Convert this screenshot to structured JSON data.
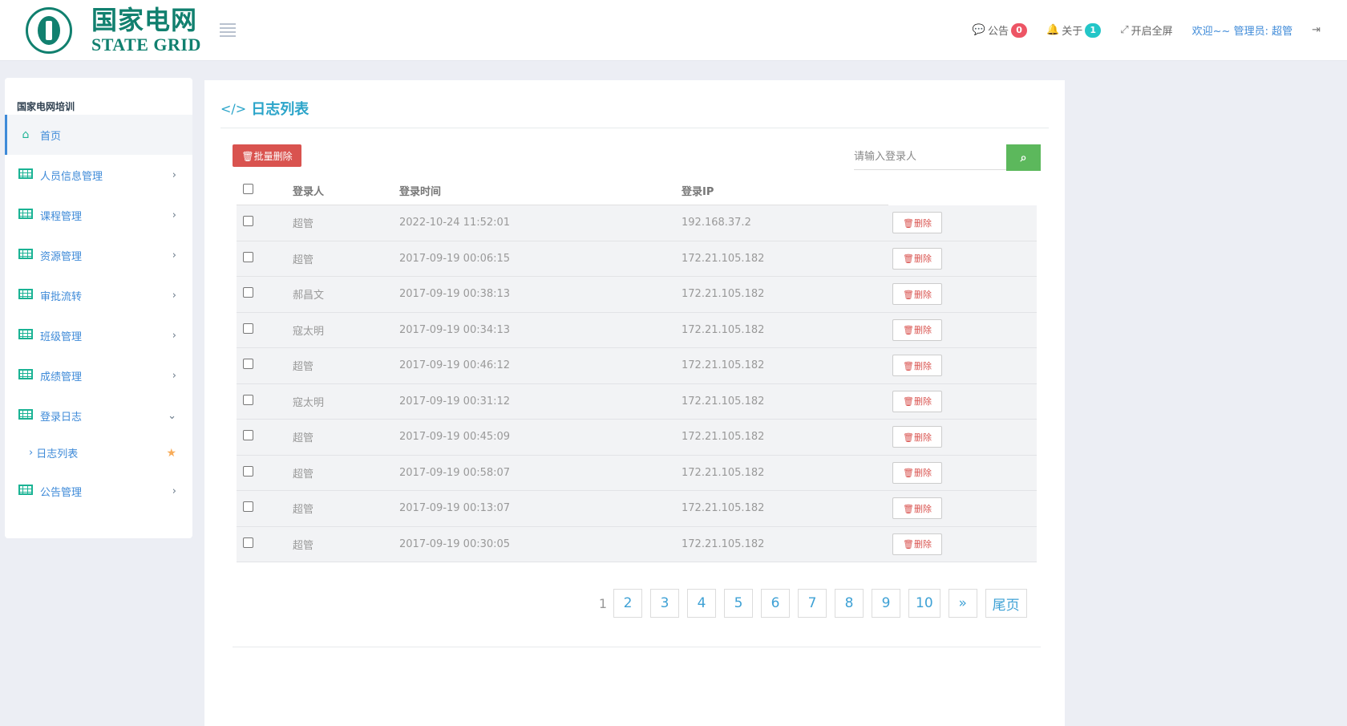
{
  "header": {
    "logo_cn": "国家电网",
    "logo_en": "STATE GRID",
    "announce_label": "公告",
    "announce_count": "0",
    "about_label": "关于",
    "about_count": "1",
    "fullscreen_label": "开启全屏",
    "welcome": "欢迎~~ 管理员: 超管"
  },
  "sidebar": {
    "title": "国家电网培训",
    "items": [
      {
        "label": "首页"
      },
      {
        "label": "人员信息管理"
      },
      {
        "label": "课程管理"
      },
      {
        "label": "资源管理"
      },
      {
        "label": "审批流转"
      },
      {
        "label": "班级管理"
      },
      {
        "label": "成绩管理"
      },
      {
        "label": "登录日志"
      },
      {
        "label": "公告管理"
      }
    ],
    "sub_item": "日志列表"
  },
  "main": {
    "title": "日志列表",
    "batch_delete": "批量删除",
    "search_placeholder": "请输入登录人",
    "columns": [
      "登录人",
      "登录时间",
      "登录IP"
    ],
    "delete_label": "删除",
    "rows": [
      {
        "user": "超管",
        "time": "2022-10-24 11:52:01",
        "ip": "192.168.37.2"
      },
      {
        "user": "超管",
        "time": "2017-09-19 00:06:15",
        "ip": "172.21.105.182"
      },
      {
        "user": "郝昌文",
        "time": "2017-09-19 00:38:13",
        "ip": "172.21.105.182"
      },
      {
        "user": "寇太明",
        "time": "2017-09-19 00:34:13",
        "ip": "172.21.105.182"
      },
      {
        "user": "超管",
        "time": "2017-09-19 00:46:12",
        "ip": "172.21.105.182"
      },
      {
        "user": "寇太明",
        "time": "2017-09-19 00:31:12",
        "ip": "172.21.105.182"
      },
      {
        "user": "超管",
        "time": "2017-09-19 00:45:09",
        "ip": "172.21.105.182"
      },
      {
        "user": "超管",
        "time": "2017-09-19 00:58:07",
        "ip": "172.21.105.182"
      },
      {
        "user": "超管",
        "time": "2017-09-19 00:13:07",
        "ip": "172.21.105.182"
      },
      {
        "user": "超管",
        "time": "2017-09-19 00:30:05",
        "ip": "172.21.105.182"
      }
    ],
    "pagination": {
      "current": "1",
      "pages": [
        "2",
        "3",
        "4",
        "5",
        "6",
        "7",
        "8",
        "9",
        "10"
      ],
      "next": "»",
      "last": "尾页"
    }
  }
}
